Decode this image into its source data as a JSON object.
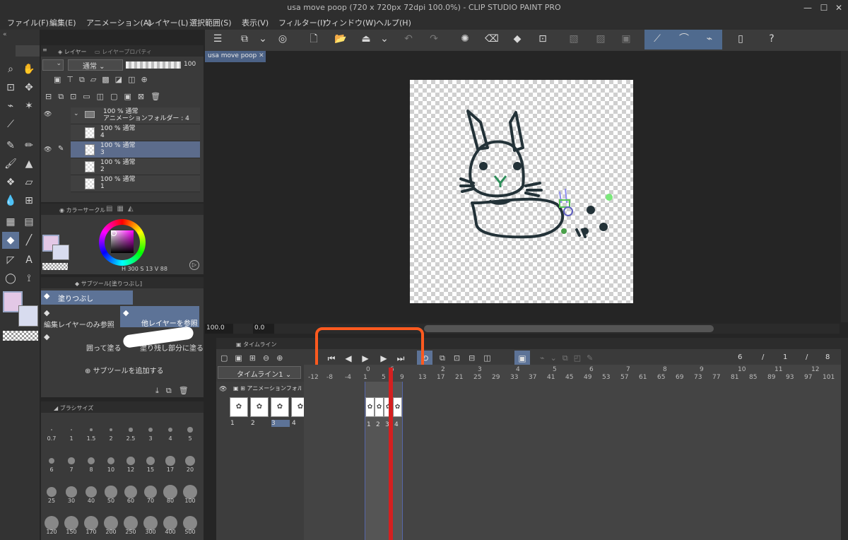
{
  "window": {
    "title": "usa move poop (720 x 720px 72dpi 100.0%) - CLIP STUDIO PAINT PRO"
  },
  "menu": [
    "ファイル(F)",
    "編集(E)",
    "アニメーション(A)",
    "レイヤー(L)",
    "選択範囲(S)",
    "表示(V)",
    "フィルター(I)",
    "ウィンドウ(W)",
    "ヘルプ(H)"
  ],
  "layer_panel": {
    "tab_layer": "レイヤー",
    "tab_property": "レイヤープロパティ",
    "blend_mode": "通常",
    "opacity": "100",
    "folder": {
      "label": "100 % 通常",
      "name": "アニメーションフォルダー : 4"
    },
    "layers": [
      {
        "label": "100 % 通常",
        "name": "4"
      },
      {
        "label": "100 % 通常",
        "name": "3"
      },
      {
        "label": "100 % 通常",
        "name": "2"
      },
      {
        "label": "100 % 通常",
        "name": "1"
      }
    ]
  },
  "color_panel": {
    "tab": "カラーサークル",
    "h": "300",
    "s": "13",
    "v": "88",
    "h_lbl": "H",
    "s_lbl": "S",
    "v_lbl": "V"
  },
  "subtool": {
    "tab": "サブツール[塗りつぶし]",
    "active": "塗りつぶし",
    "opt1": "編集レイヤーのみ参照",
    "opt2": "他レイヤーを参照",
    "opt3": "囲って塗る",
    "opt4": "塗り残し部分に塗る",
    "add": "サブツールを追加する"
  },
  "brush_size": {
    "tab": "ブラシサイズ",
    "sizes": [
      "0.7",
      "1",
      "1.5",
      "2",
      "2.5",
      "3",
      "4",
      "5",
      "6",
      "7",
      "8",
      "10",
      "12",
      "15",
      "17",
      "20",
      "25",
      "30",
      "40",
      "50",
      "60",
      "70",
      "80",
      "100",
      "120",
      "150",
      "170",
      "200",
      "250",
      "300",
      "400",
      "500"
    ]
  },
  "document": {
    "tab": "usa move poop"
  },
  "canvas_status": {
    "zoom": "100.0",
    "rotation": "0.0"
  },
  "timeline": {
    "tab": "タイムライン",
    "name": "タイムライン1",
    "folder": "アニメーションフォルダ",
    "frame_current": "6",
    "frame_sep1": "/",
    "frame_start": "1",
    "frame_sep2": "/",
    "frame_end": "8",
    "left_frames": [
      "1",
      "2",
      "3",
      "4"
    ],
    "cel_frames": [
      "1",
      "2",
      "3",
      "4"
    ],
    "ruler_top": [
      "0",
      "6",
      "2",
      "3",
      "4",
      "5",
      "6",
      "7",
      "8",
      "9",
      "10",
      "11",
      "12"
    ],
    "ruler_bottom": [
      "-12",
      "-8",
      "-4",
      "1",
      "5",
      "9",
      "13",
      "17",
      "21",
      "25",
      "29",
      "33",
      "37",
      "41",
      "45",
      "49",
      "53",
      "57",
      "61",
      "65",
      "69",
      "73",
      "77",
      "81",
      "85",
      "89",
      "93",
      "97",
      "101"
    ]
  },
  "colors": {
    "accent": "#5d7397",
    "highlight": "#ff5a1f",
    "playhead": "#d42020",
    "main_color": "#e3c8e6",
    "sub_color": "#d8dcef"
  }
}
